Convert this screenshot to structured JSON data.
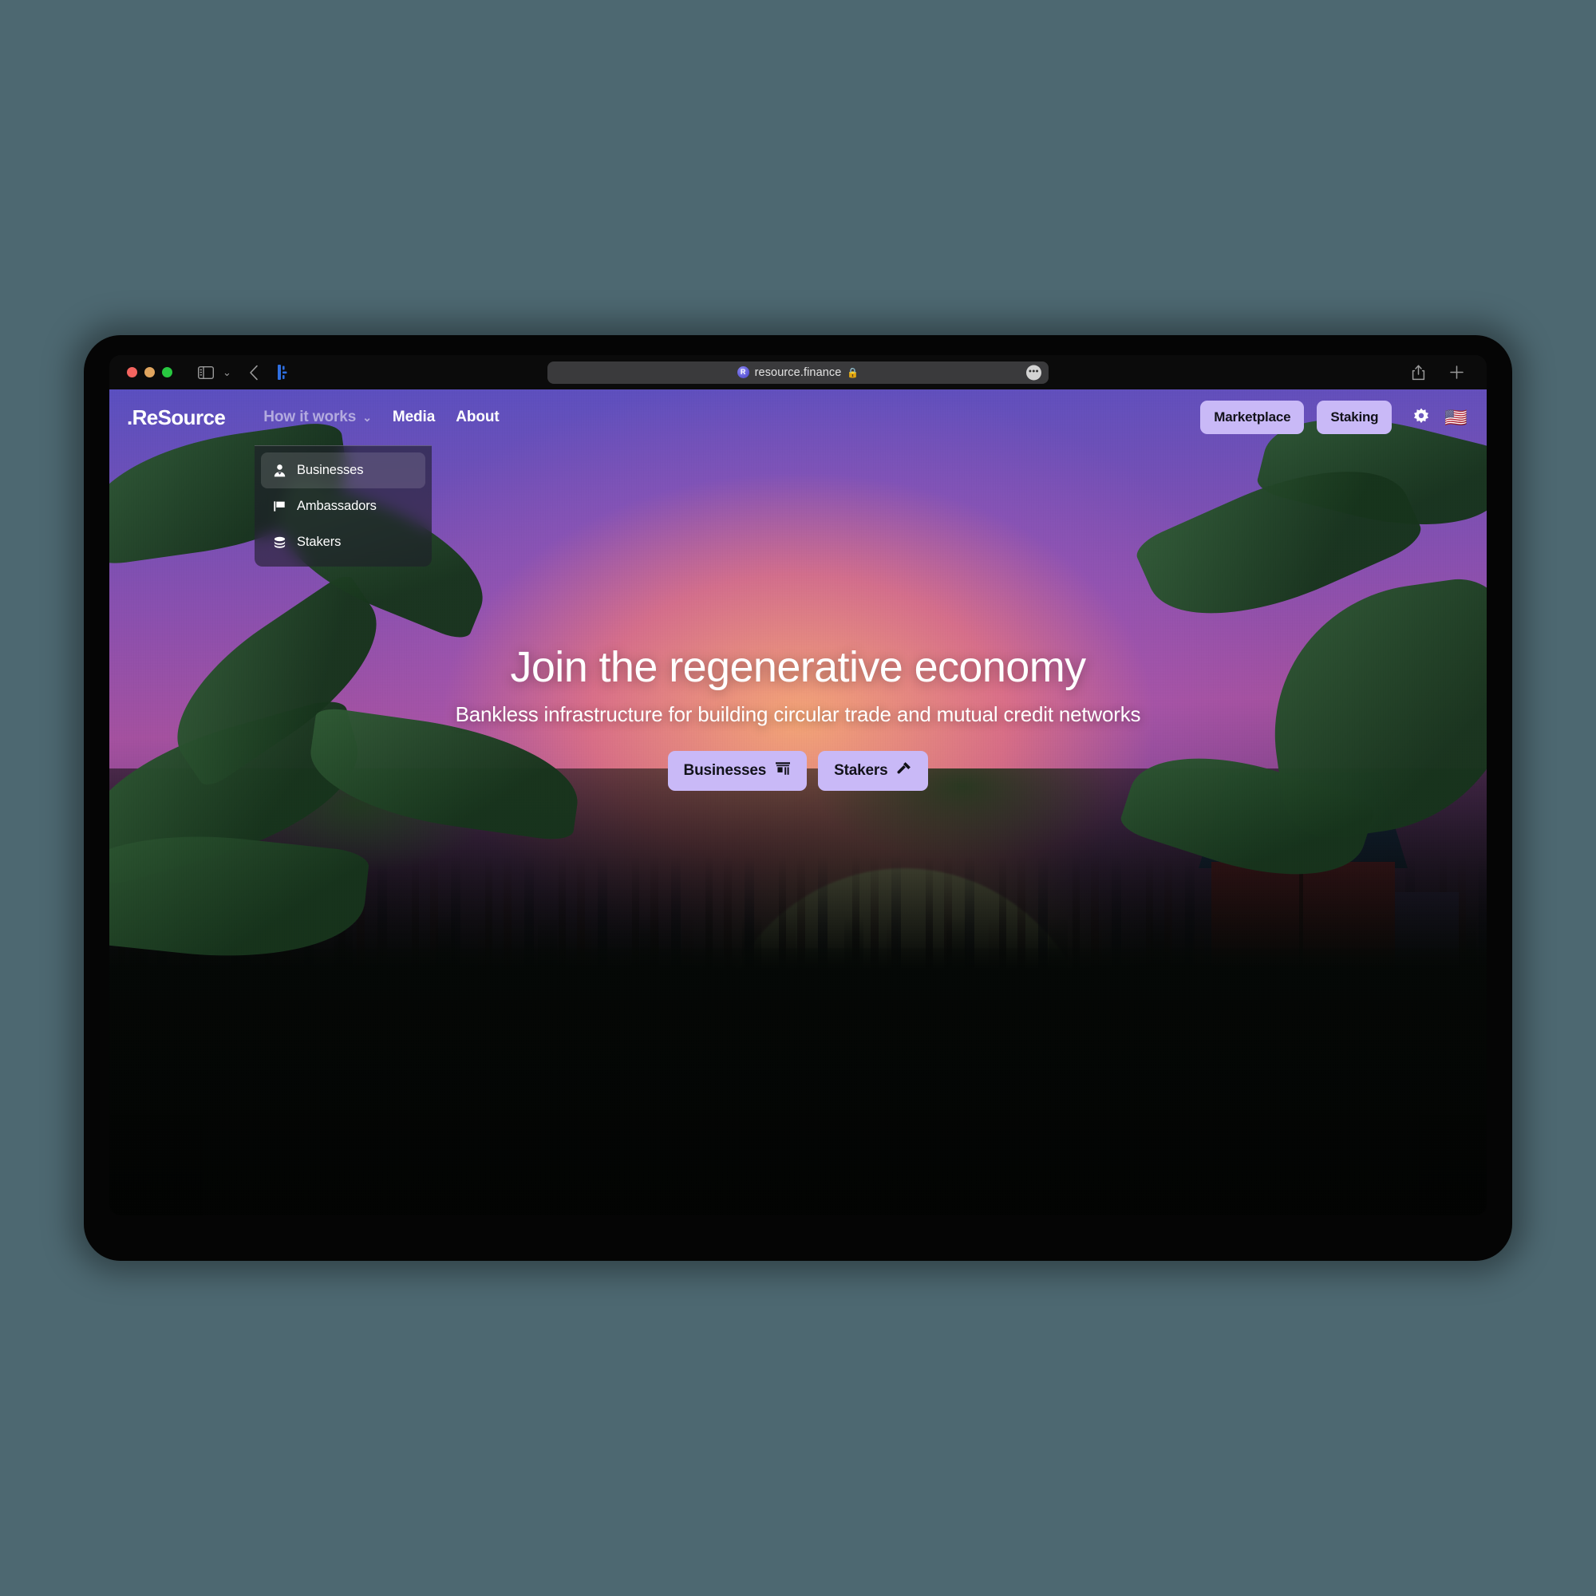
{
  "desktop": {
    "background_color": "#4d6871"
  },
  "browser": {
    "traffic_lights": [
      "close",
      "minimize",
      "zoom"
    ],
    "sidebar_toggle_label": "sidebar-toggle",
    "back_label": "back",
    "reader_label": "reader-view",
    "url": {
      "favicon_letter": "R",
      "text": "resource.finance",
      "lock": "🔒",
      "menu_label": "•••"
    },
    "share_label": "share",
    "new_tab_label": "new-tab"
  },
  "site": {
    "logo": ".ReSource",
    "nav_links": [
      {
        "label": "How it works",
        "has_chevron": true,
        "chevron": "⌄",
        "dimmed": true
      },
      {
        "label": "Media",
        "has_chevron": false,
        "dimmed": false
      },
      {
        "label": "About",
        "has_chevron": false,
        "dimmed": false
      }
    ],
    "actions": [
      {
        "label": "Marketplace"
      },
      {
        "label": "Staking"
      }
    ],
    "settings_icon": "gear-icon",
    "language_flag": "🇺🇸",
    "dropdown": {
      "items": [
        {
          "label": "Businesses",
          "icon": "person-icon",
          "active": true
        },
        {
          "label": "Ambassadors",
          "icon": "flag-icon",
          "active": false
        },
        {
          "label": "Stakers",
          "icon": "coins-icon",
          "active": false
        }
      ]
    },
    "hero": {
      "title": "Join the regenerative economy",
      "subtitle": "Bankless infrastructure for building circular trade and mutual credit networks",
      "ctas": [
        {
          "label": "Businesses",
          "icon": "storefront-icon"
        },
        {
          "label": "Stakers",
          "icon": "hammer-icon"
        }
      ]
    }
  },
  "colors": {
    "accent_purple": "#c9b9f7",
    "sky_purple": "#8a4fae",
    "sun_yellow": "#e6dfa6",
    "text_white": "#ffffff"
  }
}
